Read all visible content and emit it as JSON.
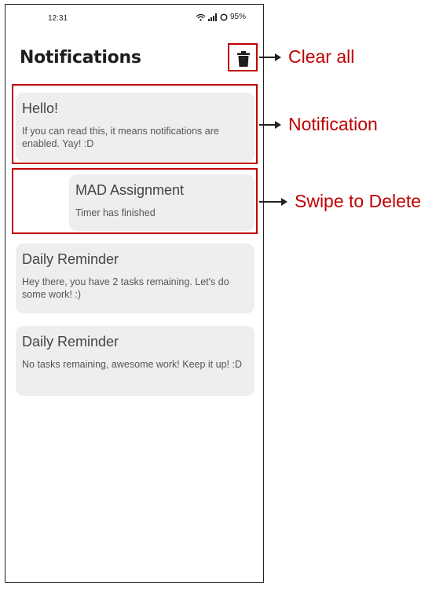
{
  "status_bar": {
    "time": "12:31",
    "battery": "95%"
  },
  "header": {
    "title": "Notifications",
    "clear_icon": "trash-icon"
  },
  "notifications": [
    {
      "title": "Hello!",
      "body": "If you can read this, it means notifications are enabled. Yay! :D"
    },
    {
      "title": "MAD Assignment",
      "body": "Timer has finished"
    },
    {
      "title": "Daily Reminder",
      "body": "Hey there, you have 2 tasks remaining. Let's do some work! :)"
    },
    {
      "title": "Daily Reminder",
      "body": "No tasks remaining, awesome work! Keep it up! :D"
    }
  ],
  "annotations": {
    "clear_all": "Clear all",
    "notification": "Notification",
    "swipe_to_delete": "Swipe to Delete"
  },
  "colors": {
    "annotation": "#c00000",
    "card_bg": "#eeeeee"
  }
}
